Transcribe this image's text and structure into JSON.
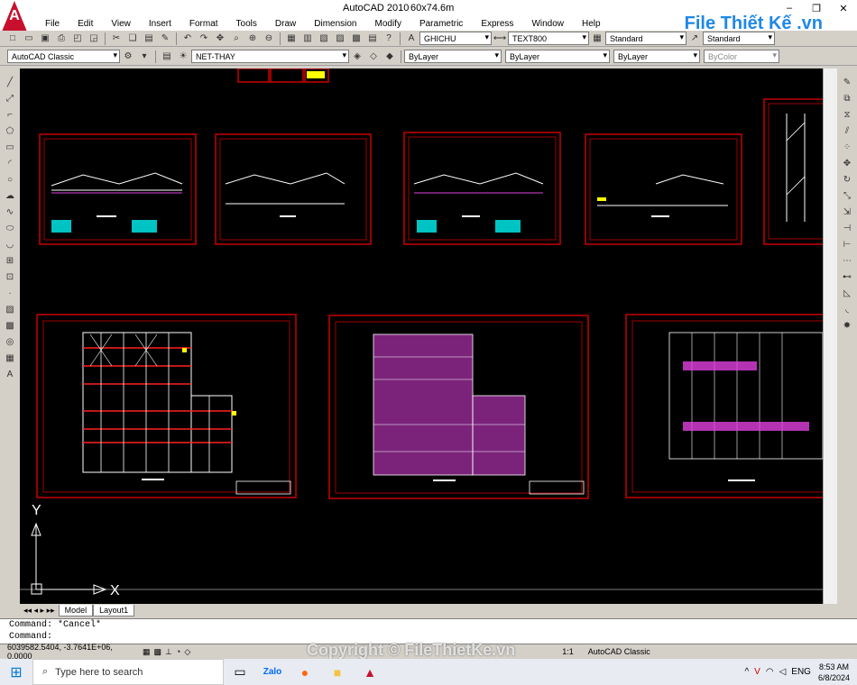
{
  "window": {
    "app_title": "AutoCAD 2010",
    "file_name": "60x74.6m",
    "minimize_label": "–",
    "restore_label": "❐",
    "close_label": "✕"
  },
  "watermark": {
    "logo_text": "File Thiết Kế .vn",
    "copyright": "Copyright © FileThietKe.vn"
  },
  "menu": [
    "File",
    "Edit",
    "View",
    "Insert",
    "Format",
    "Tools",
    "Draw",
    "Dimension",
    "Modify",
    "Parametric",
    "Express",
    "Window",
    "Help"
  ],
  "toolbar1": {
    "text_style": "GHICHU",
    "dim_style": "TEXT800",
    "table_style": "Standard",
    "multileader_style": "Standard"
  },
  "toolbar2": {
    "workspace": "AutoCAD Classic",
    "layer": "NET-THAY",
    "color": "ByLayer",
    "linetype": "ByLayer",
    "lineweight": "ByLayer",
    "plotstyle": "ByColor"
  },
  "tabs": {
    "model": "Model",
    "layout1": "Layout1"
  },
  "command": {
    "history": "Command: *Cancel*",
    "prompt": "Command:"
  },
  "status": {
    "coordinates": "6039582.5404, -3.7641E+06, 0.0000",
    "scale": "1:1",
    "workspace": "AutoCAD Classic"
  },
  "taskbar": {
    "search_placeholder": "Type here to search",
    "language": "ENG",
    "time": "8:53 AM",
    "date": "6/8/2024"
  },
  "ucs": {
    "y_label": "Y",
    "x_label": "X"
  },
  "colors": {
    "canvas": "#000000",
    "frame": "#c80000",
    "grid_line": "#ffffff",
    "beam_red": "#ff2020",
    "purlin_magenta": "#e040e0",
    "label_yellow": "#ffff00",
    "table_cyan": "#00e5e5"
  }
}
